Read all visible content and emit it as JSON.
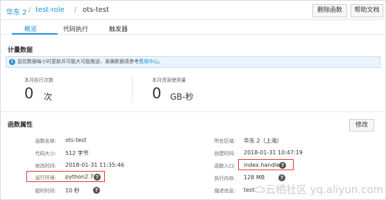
{
  "header": {
    "breadcrumb": [
      {
        "label": "华东 2",
        "type": "link"
      },
      {
        "label": "test-role",
        "type": "link"
      },
      {
        "label": "ots-test",
        "type": "text"
      }
    ],
    "separator": "/",
    "delete_button": "删除函数",
    "help_button": "帮助文档"
  },
  "tabs": [
    {
      "label": "概览",
      "active": true
    },
    {
      "label": "代码执行",
      "active": false
    },
    {
      "label": "触发器",
      "active": false
    }
  ],
  "metrics": {
    "title": "计量数据",
    "notice_text": "监控数据每小时更新并可能大可能推送，准确数据请参考",
    "notice_link": "费用中心",
    "notice_end": "。",
    "executions": {
      "label": "本月执行次数",
      "value": "0",
      "unit": "次"
    },
    "resource": {
      "label": "本月资源使用量",
      "value": "0",
      "unit": "GB-秒"
    }
  },
  "properties": {
    "title": "函数属性",
    "edit_button": "修改",
    "left": [
      {
        "label": "函数名称:",
        "value": "ots-test"
      },
      {
        "label": "代码大小:",
        "value": "512  字节"
      },
      {
        "label": "修改时间:",
        "value": "2018-01-31 11:35:46"
      },
      {
        "label": "运行环境:",
        "value": "python2.7",
        "help": true,
        "highlight": true
      },
      {
        "label": "超时时间:",
        "value": "10  秒",
        "help": true
      }
    ],
    "right": [
      {
        "label": "所在区域:",
        "value": "华东 2（上海）"
      },
      {
        "label": "创建时间:",
        "value": "2018-01-31 10:47:19"
      },
      {
        "label": "函数入口:",
        "value": "index.handler",
        "help": true,
        "highlight": true
      },
      {
        "label": "执行内存:",
        "value": "128  MB",
        "help": true
      },
      {
        "label": "描述信息:",
        "value": "test"
      }
    ]
  },
  "watermark": "云栖社区 yq.aliyun.com",
  "colors": {
    "accent": "#1a8fd8",
    "highlight_border": "#e0322b",
    "notice_bg": "#eaf4fb"
  }
}
